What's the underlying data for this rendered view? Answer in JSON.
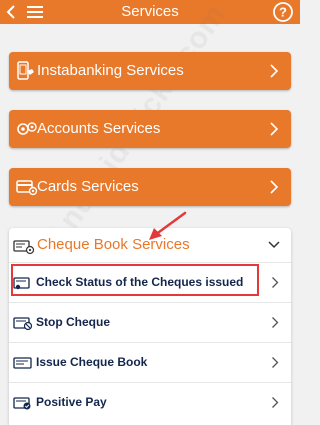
{
  "header": {
    "title": "Services",
    "back_icon": "chevron-left-icon",
    "menu_icon": "hamburger-menu-icon",
    "help_icon": "help-circle-icon",
    "help_glyph": "?"
  },
  "categories": [
    {
      "label": "Instabanking Services",
      "icon": "phone-banking-icon"
    },
    {
      "label": "Accounts Services",
      "icon": "accounts-gear-icon"
    },
    {
      "label": "Cards Services",
      "icon": "card-gear-icon"
    }
  ],
  "cheque_book": {
    "label": "Cheque Book Services",
    "icon": "cheque-book-icon",
    "expanded": true,
    "items": [
      {
        "label": "Check Status of the Cheques issued",
        "icon": "cheque-status-icon",
        "highlighted": true
      },
      {
        "label": "Stop Cheque",
        "icon": "stop-cheque-icon"
      },
      {
        "label": "Issue Cheque Book",
        "icon": "issue-cheque-icon"
      },
      {
        "label": "Positive Pay",
        "icon": "positive-pay-icon"
      }
    ]
  },
  "watermark": "AndroidTricks.com",
  "colors": {
    "brand_orange": "#e8782a",
    "annotation_red": "#e23a3a",
    "item_text_navy": "#14264d",
    "background": "#f1f1f1"
  }
}
